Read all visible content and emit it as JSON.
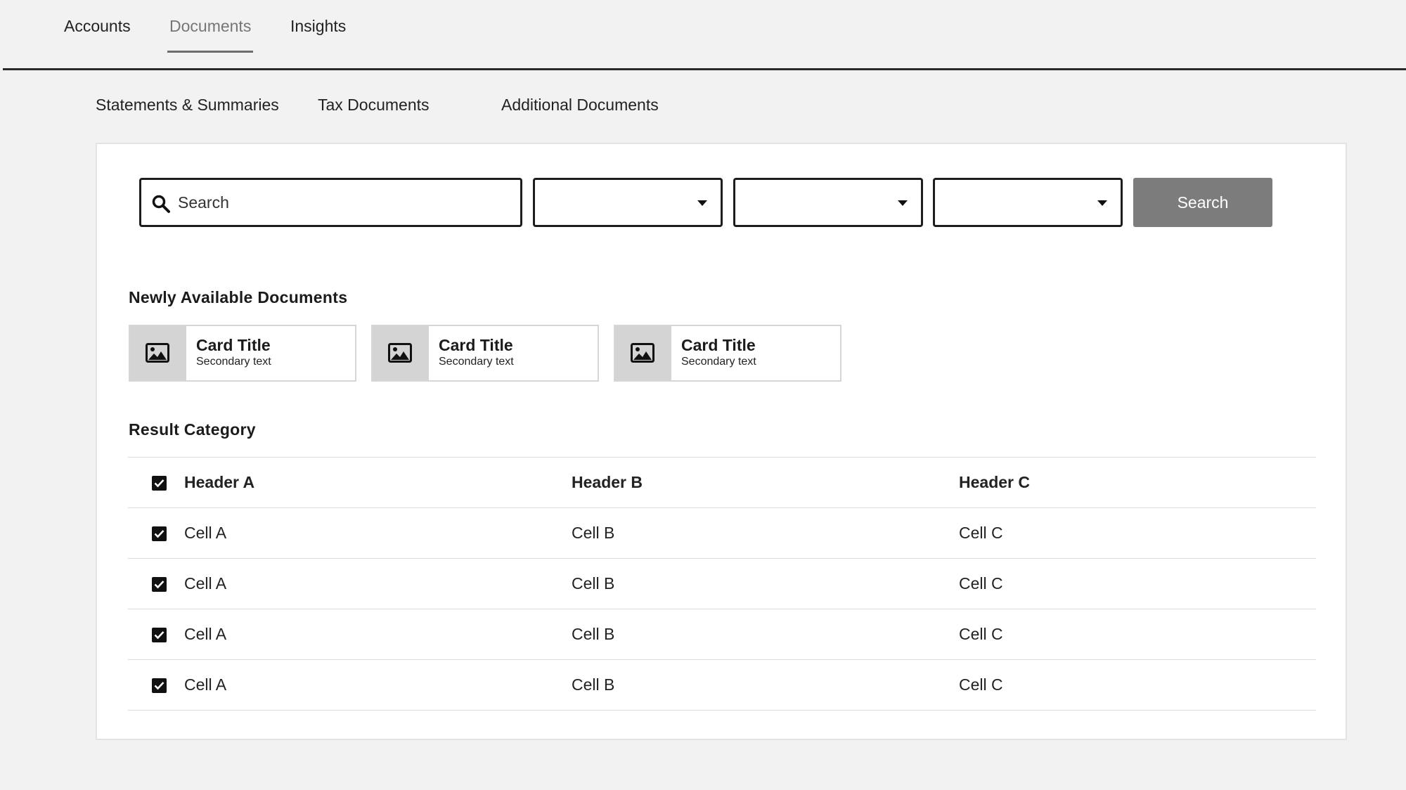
{
  "top_nav": {
    "tabs": [
      {
        "label": "Accounts"
      },
      {
        "label": "Documents"
      },
      {
        "label": "Insights"
      }
    ],
    "active_tab": "Documents"
  },
  "sub_nav": {
    "tabs": [
      {
        "label": "Statements & Summaries"
      },
      {
        "label": "Tax Documents"
      },
      {
        "label": "Additional Documents"
      }
    ]
  },
  "filters": {
    "search_placeholder": "Search",
    "search_icon": "search-icon",
    "selects": [
      {
        "value": ""
      },
      {
        "value": ""
      },
      {
        "value": ""
      }
    ],
    "search_button_label": "Search"
  },
  "new_docs": {
    "heading": "Newly Available Documents",
    "cards": [
      {
        "title": "Card Title",
        "secondary": "Secondary text",
        "icon": "image-icon"
      },
      {
        "title": "Card Title",
        "secondary": "Secondary text",
        "icon": "image-icon"
      },
      {
        "title": "Card Title",
        "secondary": "Secondary text",
        "icon": "image-icon"
      }
    ]
  },
  "results": {
    "heading": "Result Category",
    "headers": [
      "Header A",
      "Header B",
      "Header C"
    ],
    "header_checked": true,
    "rows": [
      {
        "checked": true,
        "cells": [
          "Cell A",
          "Cell B",
          "Cell C"
        ]
      },
      {
        "checked": true,
        "cells": [
          "Cell A",
          "Cell B",
          "Cell C"
        ]
      },
      {
        "checked": true,
        "cells": [
          "Cell A",
          "Cell B",
          "Cell C"
        ]
      },
      {
        "checked": true,
        "cells": [
          "Cell A",
          "Cell B",
          "Cell C"
        ]
      }
    ]
  },
  "colors": {
    "accent_button": "#7c7c7c",
    "background": "#f3f2f2",
    "panel": "#ffffff",
    "border": "#1d1d1d"
  }
}
